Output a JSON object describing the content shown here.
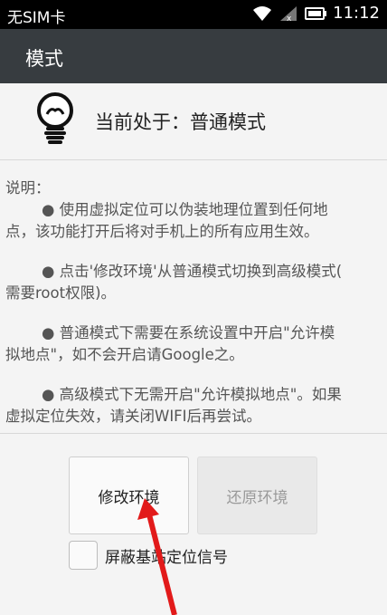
{
  "status_bar": {
    "carrier": "无SIM卡",
    "time": "11:12"
  },
  "action_bar": {
    "title": "模式"
  },
  "mode": {
    "label": "当前处于：普通模式"
  },
  "description": {
    "heading": "说明：",
    "items": [
      {
        "first": "● 使用虚拟定位可以伪装地理位置到任何地",
        "rest": "点，该功能打开后将对手机上的所有应用生效。"
      },
      {
        "first": "● 点击'修改环境'从普通模式切换到高级模式(",
        "rest": "需要root权限)。"
      },
      {
        "first": "● 普通模式下需要在系统设置中开启\"允许模",
        "rest": "拟地点\"，如不会开启请Google之。"
      },
      {
        "first": "● 高级模式下无需开启\"允许模拟地点\"。如果",
        "rest": "虚拟定位失效，请关闭WIFI后再尝试。"
      }
    ]
  },
  "buttons": {
    "modify": "修改环境",
    "restore": "还原环境"
  },
  "checkbox": {
    "label": "屏蔽基站定位信号",
    "checked": false
  }
}
